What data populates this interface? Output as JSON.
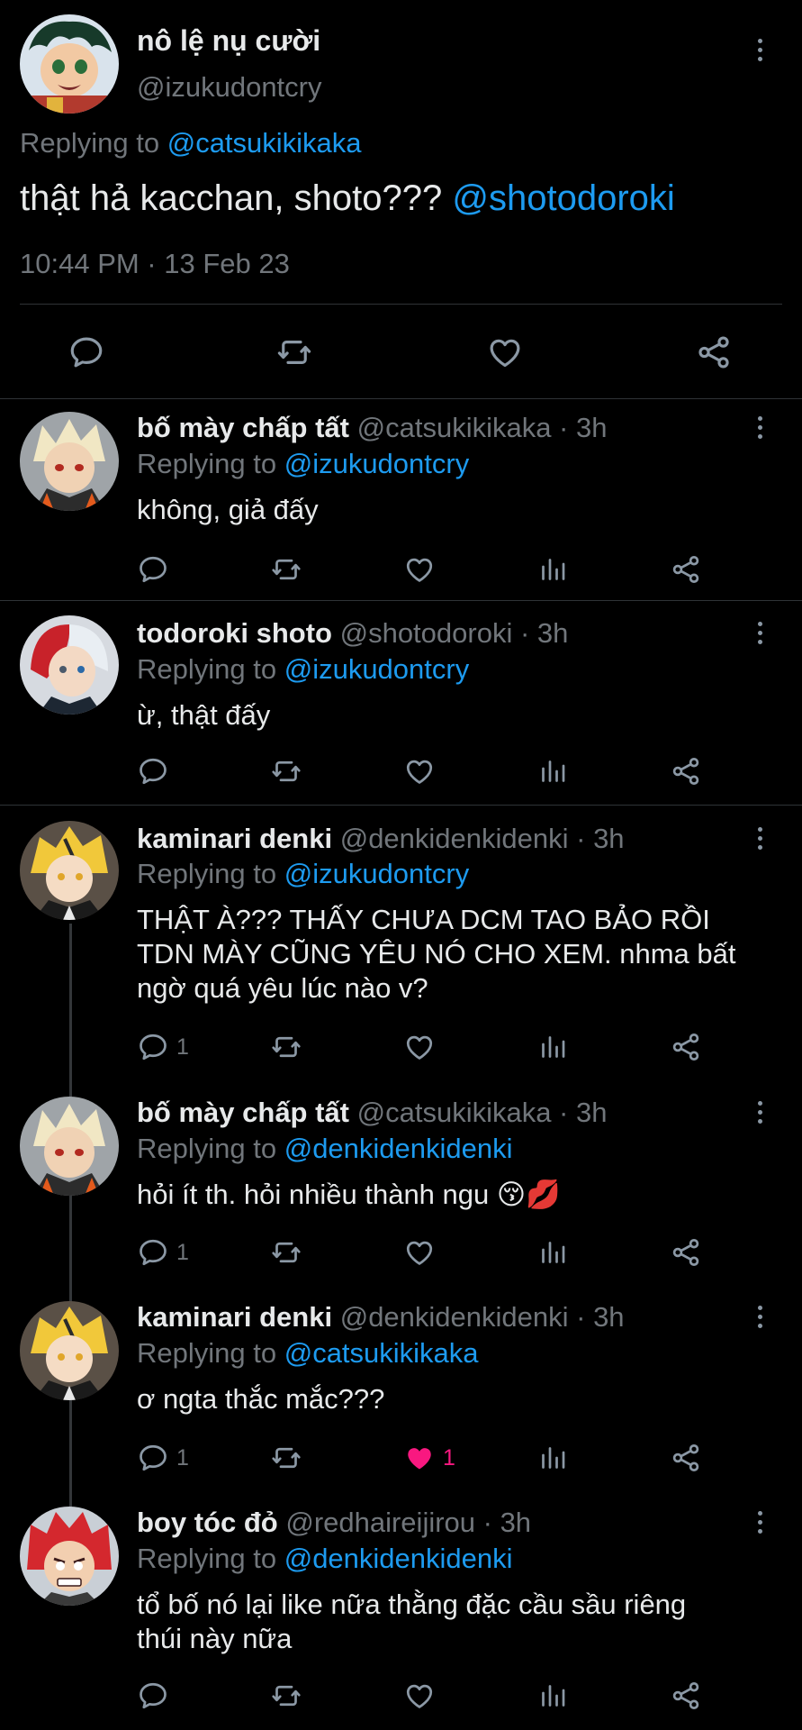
{
  "main_tweet": {
    "display_name": "nô lệ nụ cười",
    "handle": "@izukudontcry",
    "replying_prefix": "Replying to",
    "replying_to": "@catsukikikaka",
    "text": "thật hả kacchan, shoto???",
    "mention": "@shotodoroki",
    "timestamp": "10:44 PM · 13 Feb 23"
  },
  "replies": [
    {
      "display_name": "bố mày chấp tất",
      "handle_time": "@catsukikikaka · 3h",
      "replying_prefix": "Replying to",
      "replying_to": "@izukudontcry",
      "text_lines": [
        "không, giả đấy"
      ],
      "reply_count": "",
      "like_count": ""
    },
    {
      "display_name": "todoroki shoto",
      "handle_time": "@shotodoroki · 3h",
      "replying_prefix": "Replying to",
      "replying_to": "@izukudontcry",
      "text_lines": [
        "ừ, thật đấy"
      ],
      "reply_count": "",
      "like_count": ""
    },
    {
      "display_name": "kaminari denki",
      "handle_time": "@denkidenkidenki · 3h",
      "replying_prefix": "Replying to",
      "replying_to": "@izukudontcry",
      "text_lines": [
        "THẬT À??? THẤY CHƯA DCM TAO BẢO RỒI",
        "TDN MÀY CŨNG YÊU NÓ CHO XEM. nhma bất",
        "ngờ quá yêu lúc nào v?"
      ],
      "reply_count": "1",
      "like_count": ""
    },
    {
      "display_name": "bố mày chấp tất",
      "handle_time": "@catsukikikaka · 3h",
      "replying_prefix": "Replying to",
      "replying_to": "@denkidenkidenki",
      "text_lines": [
        "hỏi ít th. hỏi nhiều thành ngu 😚💋"
      ],
      "reply_count": "1",
      "like_count": ""
    },
    {
      "display_name": "kaminari denki",
      "handle_time": "@denkidenkidenki · 3h",
      "replying_prefix": "Replying to",
      "replying_to": "@catsukikikaka",
      "text_lines": [
        "ơ ngta thắc mắc???"
      ],
      "reply_count": "1",
      "like_count": "1",
      "liked": true
    },
    {
      "display_name": "boy tóc đỏ",
      "handle_time": "@redhaireijirou · 3h",
      "replying_prefix": "Replying to",
      "replying_to": "@denkidenkidenki",
      "text_lines": [
        "tổ bố nó lại like nữa thằng đặc cầu sầu riêng",
        "thúi này nữa"
      ],
      "reply_count": "",
      "like_count": ""
    }
  ],
  "icons": {
    "reply": "reply-icon",
    "retweet": "retweet-icon",
    "like": "heart-icon",
    "views": "views-icon",
    "share": "share-icon",
    "more": "more-icon"
  },
  "colors": {
    "background": "#000000",
    "link": "#1d9bf0",
    "muted": "#71767b",
    "like": "#f91880"
  }
}
